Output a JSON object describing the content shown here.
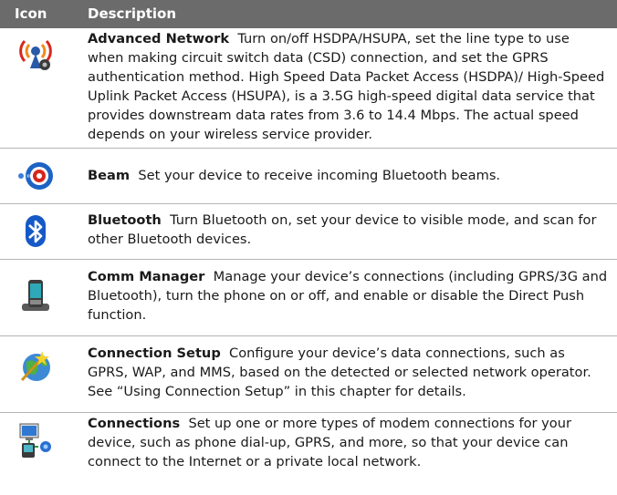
{
  "header": {
    "icon_col": "Icon",
    "description_col": "Description"
  },
  "rows": [
    {
      "title": "Advanced Network",
      "text": "Turn on/off HSDPA/HSUPA, set the line type to use when making circuit switch data (CSD) connection, and set the GPRS authentication method. High Speed Data Packet Access (HSDPA)/ High-Speed Uplink Packet Access (HSUPA), is a 3.5G high-speed digital data service that provides downstream data rates from 3.6 to 14.4 Mbps. The actual speed depends on your wireless service provider.",
      "icon": "advanced-network-icon"
    },
    {
      "title": "Beam",
      "text": "Set your device to receive incoming Bluetooth beams.",
      "icon": "beam-icon"
    },
    {
      "title": "Bluetooth",
      "text": "Turn Bluetooth on, set your device to visible mode, and scan for other Bluetooth devices.",
      "icon": "bluetooth-icon"
    },
    {
      "title": "Comm Manager",
      "text": "Manage your device’s connections (including GPRS/3G and Bluetooth), turn the phone on or off, and enable or disable the Direct Push function.",
      "icon": "comm-manager-icon"
    },
    {
      "title": "Connection Setup",
      "text": "Configure your device’s data connections, such as GPRS, WAP, and MMS, based on the detected or selected network operator. See “Using Connection Setup” in this chapter for details.",
      "icon": "connection-setup-icon"
    },
    {
      "title": "Connections",
      "text": "Set up one or more types of modem connections for your device, such as phone dial-up, GPRS, and more, so that your device can connect to the Internet or a private local network.",
      "icon": "connections-icon"
    }
  ]
}
